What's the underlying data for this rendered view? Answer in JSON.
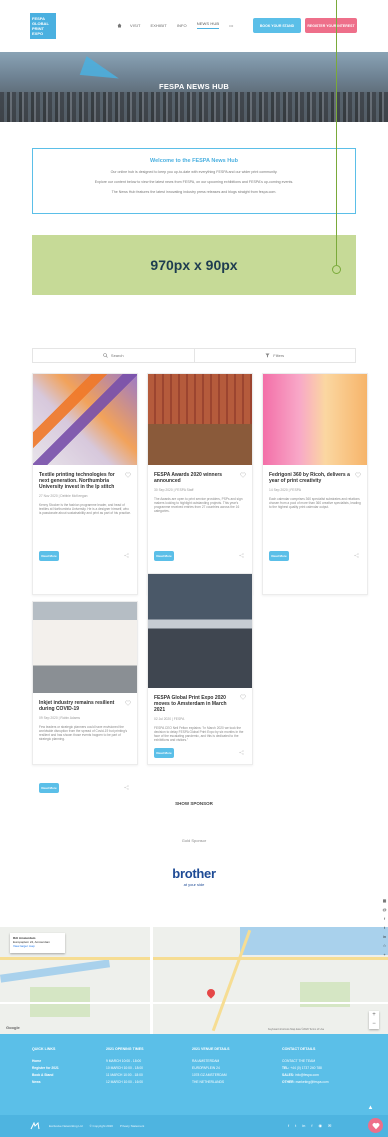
{
  "header": {
    "logo_lines": [
      "FESPA",
      "GLOBAL",
      "PRINT",
      "EXPO"
    ],
    "nav": [
      "VISIT",
      "EXHIBIT",
      "INFO",
      "NEWS HUB"
    ],
    "more_label": "•••",
    "book_stand_label": "BOOK YOUR STAND",
    "register_label": "REGISTER YOUR INTEREST"
  },
  "hero": {
    "title": "FESPA NEWS HUB"
  },
  "welcome": {
    "heading": "Welcome to the FESPA News Hub",
    "lines": [
      "Our online hub is designed to keep you up-to-date with everything FESPA and our wider print community.",
      "Explore our content below to view the latest news from FESPA, on our upcoming exhibitions and FESPA's up-coming events.",
      "The News Hub features the latest innovating industry press releases and blogs straight from fespa.com."
    ]
  },
  "ad": {
    "label": "970px x 90px"
  },
  "toolbar": {
    "search_label": "Search",
    "filters_label": "Filters"
  },
  "cards": [
    {
      "title": "Textile printing technologies for next generation. Northumbria University invest in the Ip stitch",
      "meta": "27 Nov 2020 | Debbie McKeegan",
      "desc": "Kenny Stocker is the fashion programme leader, and head of textiles at Northumbria University. He is a designer himself, who is passionate about sustainability and print as part of his practice.",
      "read_more": "Read More"
    },
    {
      "title": "FESPA Awards 2020 winners announced",
      "meta": "30 Sep 2020 | FESPA Staff",
      "desc": "The Awards are open to print service providers, PSPs and sign makers looking to highlight outstanding projects. This year's programme received entries from 27 countries across the 16 categories.",
      "read_more": "Read More"
    },
    {
      "title": "Fedrigoni 360 by Ricoh, delivers a year of print creativity",
      "meta": "14 Sep 2020 | FESPA",
      "desc": "Each calendar comprises 360 specialist substrates and relations chosen from a pool of more than 360 creative specialists, leading to the highest quality print calendar output.",
      "read_more": "Read More"
    },
    {
      "title": "Inkjet industry remains resilient during COVID-19",
      "meta": "09 Sep 2020 | Robin Adams",
      "desc": "Few leaders or strategic planners could have envisioned the worldwide disruption from the spread of Covid-19 but printing's resilient and has shown those events happen to be part of strategic planning.",
      "read_more": "Read More"
    },
    {
      "title": "FESPA Global Print Expo 2020 moves to Amsterdam in March 2021",
      "meta": "02 Jul 2020 | FESPA",
      "desc": "FESPA CEO Neil Felton explains: \"In March 2020 we took the decision to delay FESPA Global Print Expo by six months in the face of the escalating pandemic, and this is dedicated to the exhibitions and visitors.\"",
      "read_more": "Read More"
    }
  ],
  "sponsor": {
    "heading": "SHOW SPONSOR",
    "tier": "Gold Sponsor",
    "brand": "brother",
    "tagline": "at your side"
  },
  "map": {
    "place_name": "RAI Amsterdam",
    "place_addr": "Europaplein 24, Amsterdam",
    "link_text": "View larger map",
    "google": "Google",
    "attribution": "Keyboard shortcuts  Map data ©2020  Terms of Use"
  },
  "sidebar_icons": [
    "▦",
    "@",
    "f",
    "t",
    "in",
    "☆",
    "+"
  ],
  "footer": {
    "quick_links": {
      "heading": "QUICK LINKS",
      "items": [
        "Home",
        "Register for 2021",
        "Book A Stand",
        "News"
      ]
    },
    "opening": {
      "heading": "2021 OPENING TIMES",
      "items": [
        "9 MARCH 10:00 - 18:00",
        "10 MARCH 10:00 - 18:00",
        "11 MARCH 10:00 - 18:00",
        "12 MARCH 10:00 - 16:00"
      ]
    },
    "venue": {
      "heading": "2021 VENUE DETAILS",
      "items": [
        "RAI AMSTERDAM",
        "EUROPAPLEIN 24",
        "1078 GZ AMSTERDAM",
        "THE NETHERLANDS"
      ]
    },
    "contact": {
      "heading": "CONTACT DETAILS",
      "intro": "CONTACT THE TEAM",
      "tel_label": "TEL:",
      "tel": "+44 (0) 1737 240 788",
      "sales_label": "SALES:",
      "sales": "info@fespa.com",
      "other_label": "OTHER:",
      "other": "marketing@fespa.com"
    },
    "up_arrow": "▲",
    "bottom": {
      "items": [
        "Exclusive Networking Ltd",
        "© Copyright 2020",
        "Privacy Statement"
      ]
    },
    "social": [
      "f",
      "t",
      "in",
      "f",
      "◉",
      "✉"
    ]
  }
}
